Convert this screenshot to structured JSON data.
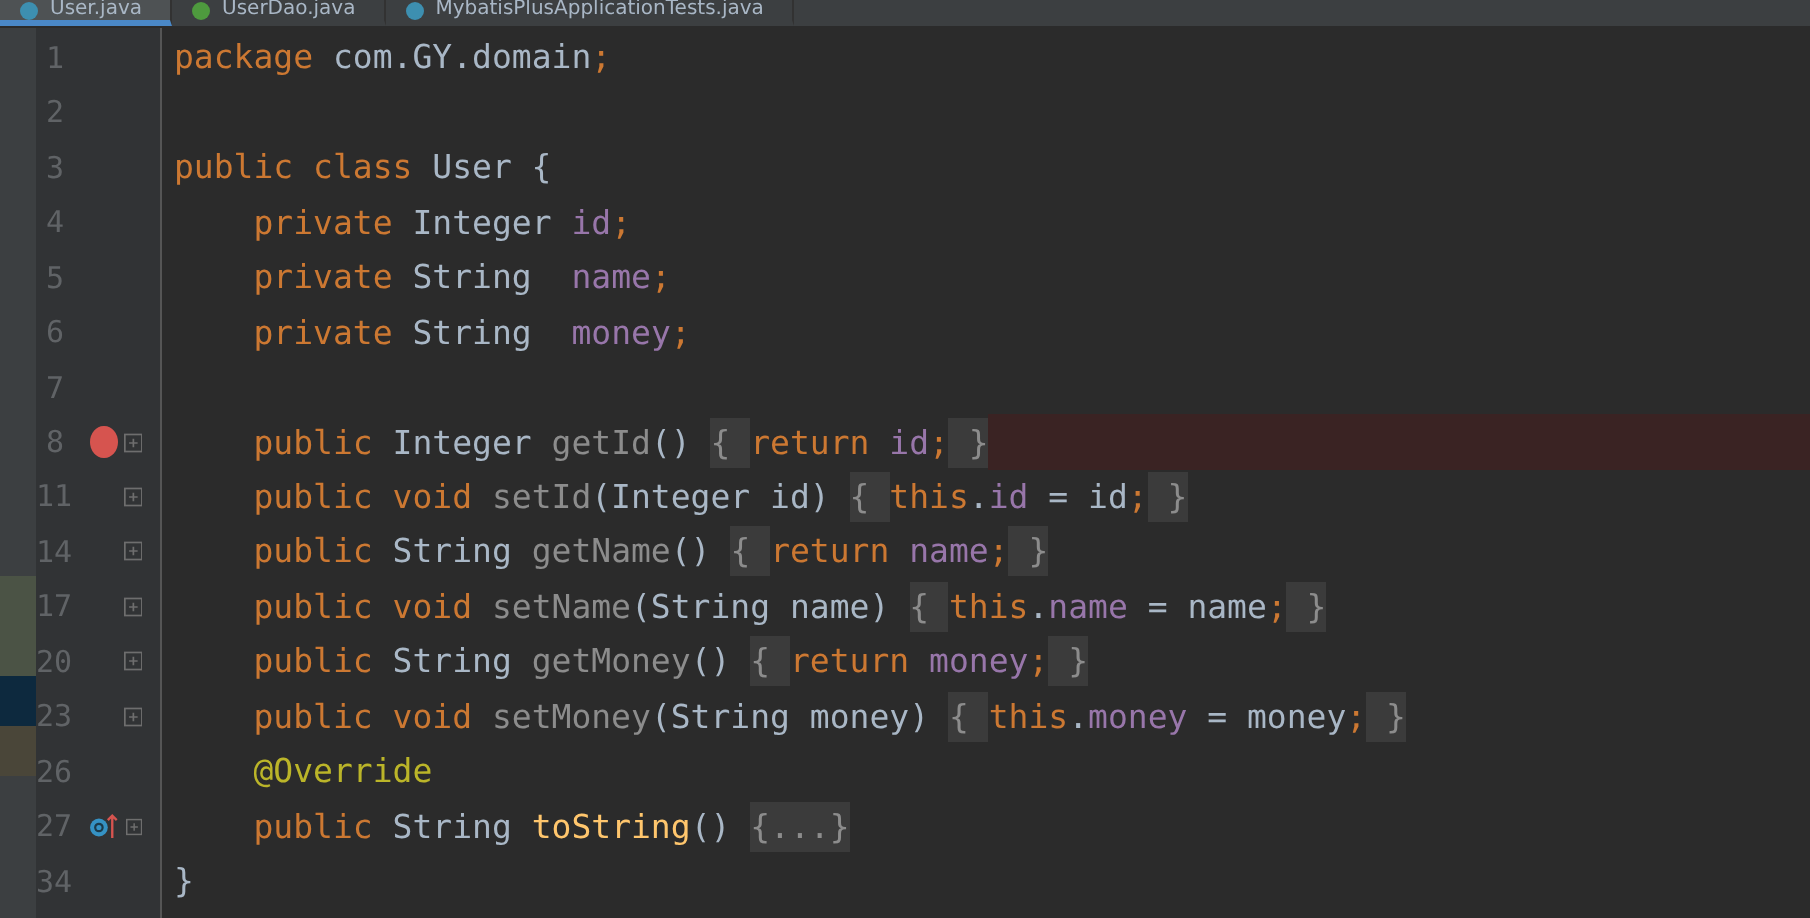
{
  "tabs": [
    {
      "label": "User.java",
      "selected": true,
      "color": "#3d8fb0"
    },
    {
      "label": "UserDao.java",
      "selected": false,
      "color": "#4e9a3e"
    },
    {
      "label": "MybatisPlusApplicationTests.java",
      "selected": false,
      "color": "#3d8fb0"
    }
  ],
  "lines": [
    {
      "number": "1",
      "indent": false,
      "tokens": [
        {
          "kind": "kw",
          "text": "package "
        },
        {
          "kind": "plain",
          "text": "com.GY.domain"
        },
        {
          "kind": "kw",
          "text": ";"
        }
      ]
    },
    {
      "number": "2"
    },
    {
      "number": "3",
      "indent": false,
      "tokens": [
        {
          "kind": "kw",
          "text": "public class "
        },
        {
          "kind": "plain",
          "text": "User {"
        }
      ]
    },
    {
      "number": "4",
      "indent": true,
      "tokens": [
        {
          "kind": "kw",
          "text": "private "
        },
        {
          "kind": "plain",
          "text": "Integer "
        },
        {
          "kind": "field",
          "text": "id"
        },
        {
          "kind": "kw",
          "text": ";"
        }
      ]
    },
    {
      "number": "5",
      "indent": true,
      "tokens": [
        {
          "kind": "kw",
          "text": "private "
        },
        {
          "kind": "plain",
          "text": "String  "
        },
        {
          "kind": "field",
          "text": "name"
        },
        {
          "kind": "kw",
          "text": ";"
        }
      ]
    },
    {
      "number": "6",
      "indent": true,
      "tokens": [
        {
          "kind": "kw",
          "text": "private "
        },
        {
          "kind": "plain",
          "text": "String  "
        },
        {
          "kind": "field",
          "text": "money"
        },
        {
          "kind": "kw",
          "text": ";"
        }
      ]
    },
    {
      "number": "7"
    },
    {
      "number": "8",
      "indent": true,
      "breakpoint": true,
      "fold": true,
      "tokens": [
        {
          "kind": "kw",
          "text": "public "
        },
        {
          "kind": "plain",
          "text": "Integer "
        },
        {
          "kind": "method",
          "text": "getId"
        },
        {
          "kind": "plain",
          "text": "() "
        },
        {
          "kind": "fold",
          "text": "{ "
        },
        {
          "kind": "kw",
          "text": "return "
        },
        {
          "kind": "field",
          "text": "id"
        },
        {
          "kind": "kw",
          "text": ";"
        },
        {
          "kind": "fold",
          "text": " }"
        }
      ]
    },
    {
      "number": "11",
      "indent": true,
      "fold": true,
      "tokens": [
        {
          "kind": "kw",
          "text": "public void "
        },
        {
          "kind": "method",
          "text": "setId"
        },
        {
          "kind": "plain",
          "text": "(Integer id) "
        },
        {
          "kind": "fold",
          "text": "{ "
        },
        {
          "kind": "kw",
          "text": "this"
        },
        {
          "kind": "plain",
          "text": "."
        },
        {
          "kind": "field",
          "text": "id"
        },
        {
          "kind": "plain",
          "text": " = id"
        },
        {
          "kind": "kw",
          "text": ";"
        },
        {
          "kind": "fold",
          "text": " }"
        }
      ]
    },
    {
      "number": "14",
      "indent": true,
      "fold": true,
      "tokens": [
        {
          "kind": "kw",
          "text": "public "
        },
        {
          "kind": "plain",
          "text": "String "
        },
        {
          "kind": "method",
          "text": "getName"
        },
        {
          "kind": "plain",
          "text": "() "
        },
        {
          "kind": "fold",
          "text": "{ "
        },
        {
          "kind": "kw",
          "text": "return "
        },
        {
          "kind": "field",
          "text": "name"
        },
        {
          "kind": "kw",
          "text": ";"
        },
        {
          "kind": "fold",
          "text": " }"
        }
      ]
    },
    {
      "number": "17",
      "indent": true,
      "fold": true,
      "tokens": [
        {
          "kind": "kw",
          "text": "public void "
        },
        {
          "kind": "method",
          "text": "setName"
        },
        {
          "kind": "plain",
          "text": "(String name) "
        },
        {
          "kind": "fold",
          "text": "{ "
        },
        {
          "kind": "kw",
          "text": "this"
        },
        {
          "kind": "plain",
          "text": "."
        },
        {
          "kind": "field",
          "text": "name"
        },
        {
          "kind": "plain",
          "text": " = name"
        },
        {
          "kind": "kw",
          "text": ";"
        },
        {
          "kind": "fold",
          "text": " }"
        }
      ]
    },
    {
      "number": "20",
      "indent": true,
      "fold": true,
      "tokens": [
        {
          "kind": "kw",
          "text": "public "
        },
        {
          "kind": "plain",
          "text": "String "
        },
        {
          "kind": "method",
          "text": "getMoney"
        },
        {
          "kind": "plain",
          "text": "() "
        },
        {
          "kind": "fold",
          "text": "{ "
        },
        {
          "kind": "kw",
          "text": "return "
        },
        {
          "kind": "field",
          "text": "money"
        },
        {
          "kind": "kw",
          "text": ";"
        },
        {
          "kind": "fold",
          "text": " }"
        }
      ]
    },
    {
      "number": "23",
      "indent": true,
      "fold": true,
      "tokens": [
        {
          "kind": "kw",
          "text": "public void "
        },
        {
          "kind": "method",
          "text": "setMoney"
        },
        {
          "kind": "plain",
          "text": "(String money) "
        },
        {
          "kind": "fold",
          "text": "{ "
        },
        {
          "kind": "kw",
          "text": "this"
        },
        {
          "kind": "plain",
          "text": "."
        },
        {
          "kind": "field",
          "text": "money"
        },
        {
          "kind": "plain",
          "text": " = money"
        },
        {
          "kind": "kw",
          "text": ";"
        },
        {
          "kind": "fold",
          "text": " }"
        }
      ]
    },
    {
      "number": "26",
      "indent": true,
      "tokens": [
        {
          "kind": "annotation",
          "text": "@Override"
        }
      ]
    },
    {
      "number": "27",
      "indent": true,
      "override": true,
      "fold": true,
      "tokens": [
        {
          "kind": "kw",
          "text": "public "
        },
        {
          "kind": "plain",
          "text": "String "
        },
        {
          "kind": "decl",
          "text": "toString"
        },
        {
          "kind": "plain",
          "text": "() "
        },
        {
          "kind": "fold",
          "text": "{...}"
        }
      ]
    },
    {
      "number": "34",
      "indent": false,
      "tokens": [
        {
          "kind": "plain",
          "text": "}"
        }
      ]
    }
  ]
}
